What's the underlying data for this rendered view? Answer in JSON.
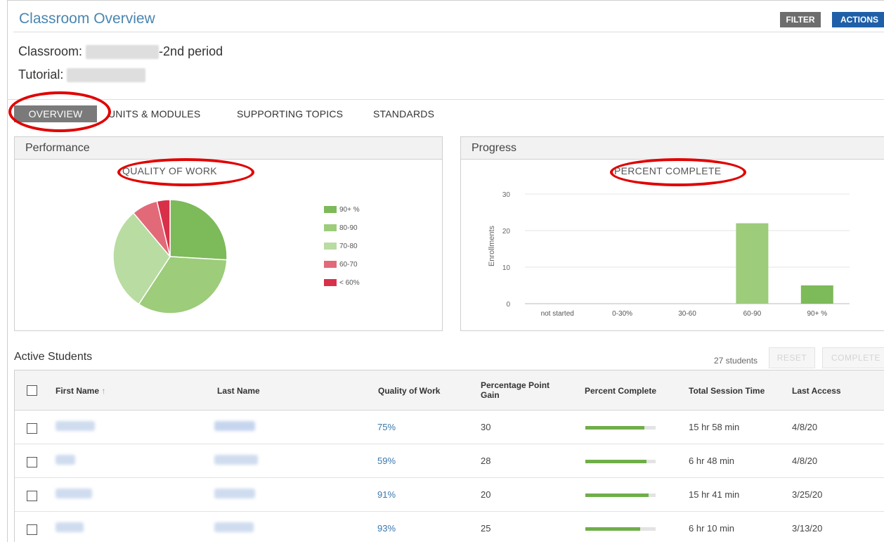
{
  "header": {
    "title": "Classroom Overview",
    "filter_label": "FILTER",
    "actions_label": "ACTIONS"
  },
  "info": {
    "classroom_label": "Classroom:",
    "classroom_suffix": "-2nd period",
    "tutorial_label": "Tutorial:"
  },
  "tabs": [
    {
      "label": "OVERVIEW",
      "active": true
    },
    {
      "label": "UNITS & MODULES"
    },
    {
      "label": "SUPPORTING TOPICS"
    },
    {
      "label": "STANDARDS"
    }
  ],
  "performance": {
    "panel_title": "Performance",
    "chart_title": "QUALITY OF WORK"
  },
  "progress": {
    "panel_title": "Progress",
    "chart_title": "PERCENT COMPLETE",
    "ylabel": "Enrollments"
  },
  "colors": {
    "90+": "#7dba5a",
    "80-90": "#9dcc7a",
    "70-80": "#b9dca2",
    "60-70": "#e26a78",
    "<60": "#d9304a",
    "bar": "#9dcc7a",
    "bar_90": "#7dba5a",
    "accent": "#1f5fa8",
    "link": "#3a78ac"
  },
  "chart_data": [
    {
      "type": "pie",
      "title": "QUALITY OF WORK",
      "categories": [
        "90+ %",
        "80-90",
        "70-80",
        "60-70",
        "< 60%"
      ],
      "values": [
        7,
        9,
        8,
        2,
        1
      ]
    },
    {
      "type": "bar",
      "title": "PERCENT COMPLETE",
      "categories": [
        "not started",
        "0-30%",
        "30-60",
        "60-90",
        "90+ %"
      ],
      "values": [
        0,
        0,
        0,
        22,
        5
      ],
      "ylabel": "Enrollments",
      "ylim": [
        0,
        30
      ],
      "yticks": [
        0,
        10,
        20,
        30
      ],
      "grid": true
    }
  ],
  "students": {
    "section_title": "Active Students",
    "count": "27 students",
    "reset_label": "RESET",
    "complete_label": "COMPLETE",
    "columns": {
      "first_name": "First Name",
      "sort_icon": "↑",
      "last_name": "Last Name",
      "quality": "Quality of Work",
      "gain_line1": "Percentage Point",
      "gain_line2": "Gain",
      "percent_complete": "Percent Complete",
      "session_time": "Total Session Time",
      "last_access": "Last Access"
    },
    "rows": [
      {
        "quality": "75%",
        "gain": "30",
        "complete": 0.84,
        "session": "15 hr 58 min",
        "access": "4/8/20"
      },
      {
        "quality": "59%",
        "gain": "28",
        "complete": 0.87,
        "session": "6 hr 48 min",
        "access": "4/8/20"
      },
      {
        "quality": "91%",
        "gain": "20",
        "complete": 0.9,
        "session": "15 hr 41 min",
        "access": "3/25/20"
      },
      {
        "quality": "93%",
        "gain": "25",
        "complete": 0.78,
        "session": "6 hr 10 min",
        "access": "3/13/20"
      }
    ]
  }
}
